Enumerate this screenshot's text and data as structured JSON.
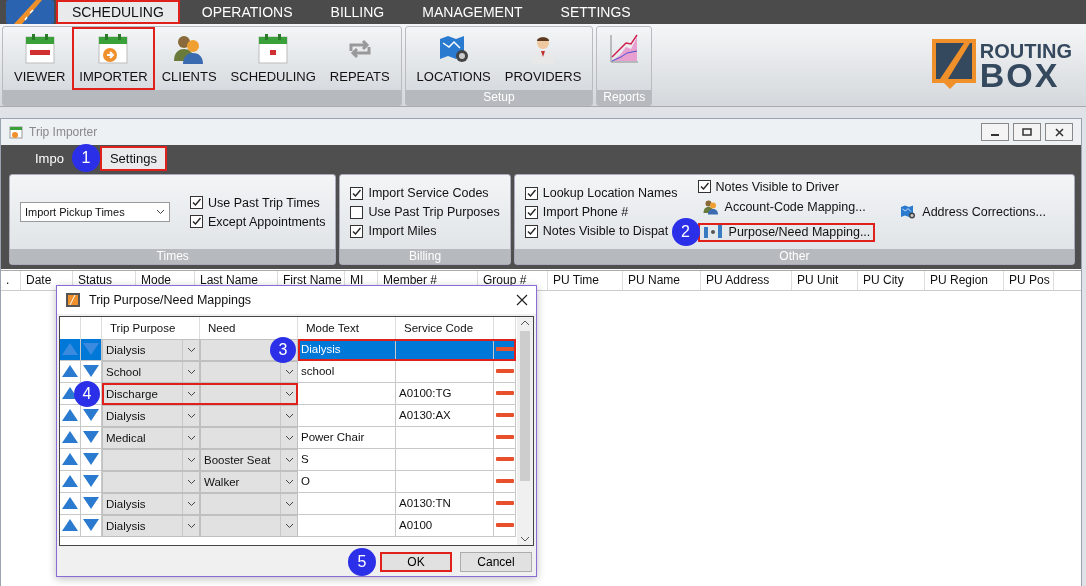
{
  "menu": [
    {
      "label": "SCHEDULING",
      "selected": true,
      "highlighted": true
    },
    {
      "label": "OPERATIONS",
      "selected": false,
      "highlighted": false
    },
    {
      "label": "BILLING",
      "selected": false,
      "highlighted": false
    },
    {
      "label": "MANAGEMENT",
      "selected": false,
      "highlighted": false
    },
    {
      "label": "SETTINGS",
      "selected": false,
      "highlighted": false
    }
  ],
  "ribbon": {
    "groups": [
      {
        "buttons": [
          {
            "label": "VIEWER",
            "highlighted": false
          },
          {
            "label": "IMPORTER",
            "highlighted": true
          },
          {
            "label": "CLIENTS",
            "highlighted": false
          },
          {
            "label": "SCHEDULING",
            "highlighted": false
          },
          {
            "label": "REPEATS",
            "highlighted": false
          }
        ]
      },
      {
        "label": "Setup",
        "buttons": [
          {
            "label": "LOCATIONS",
            "highlighted": false
          },
          {
            "label": "PROVIDERS",
            "highlighted": false
          }
        ]
      },
      {
        "label": "Reports",
        "buttons": [
          {
            "highlighted": false
          }
        ]
      }
    ],
    "logo": {
      "line1": "ROUTING",
      "line2": "BOX"
    }
  },
  "window": {
    "title": "Trip Importer",
    "tabs": [
      {
        "label": "Impo",
        "selected": false,
        "highlighted": false
      },
      {
        "label": "Settings",
        "selected": true,
        "highlighted": true,
        "callout": "1"
      }
    ],
    "groups": [
      {
        "label": "Times",
        "columns": [
          [
            {
              "kind": "select",
              "value": "Import Pickup Times"
            }
          ],
          [
            {
              "kind": "checkbox",
              "label": "Use Past Trip Times",
              "checked": true
            },
            {
              "kind": "checkbox",
              "label": "Except Appointments",
              "checked": true
            }
          ]
        ]
      },
      {
        "label": "Billing",
        "columns": [
          [
            {
              "kind": "checkbox",
              "label": "Import Service Codes",
              "checked": true
            },
            {
              "kind": "checkbox",
              "label": "Use Past Trip Purposes",
              "checked": false
            },
            {
              "kind": "checkbox",
              "label": "Import Miles",
              "checked": true
            }
          ]
        ]
      },
      {
        "label": "Other",
        "columns": [
          [
            {
              "kind": "checkbox",
              "label": "Lookup Location Names",
              "checked": true
            },
            {
              "kind": "checkbox",
              "label": "Import Phone #",
              "checked": true
            },
            {
              "kind": "checkbox",
              "label": "Notes Visible to Dispat",
              "checked": true
            }
          ],
          [
            {
              "kind": "checkbox",
              "label": "Notes Visible to Driver",
              "checked": true
            },
            {
              "kind": "link",
              "label": "Account-Code Mapping...",
              "highlighted": false
            },
            {
              "kind": "link",
              "label": "Purpose/Need Mapping...",
              "highlighted": true,
              "callout": "2"
            }
          ],
          [
            {
              "kind": "link",
              "label": "Address Corrections...",
              "highlighted": false
            }
          ]
        ]
      }
    ],
    "table": {
      "columns": [
        ".",
        "Date",
        "Status",
        "Mode",
        "Last Name",
        "First Name",
        "MI",
        "Member #",
        "Group #",
        "PU Time",
        "PU Name",
        "PU Address",
        "PU Unit",
        "PU City",
        "PU Region",
        "PU Pos"
      ]
    }
  },
  "dialog": {
    "title": "Trip Purpose/Need Mappings",
    "columns": [
      "Trip Purpose",
      "Need",
      "Mode Text",
      "Service Code"
    ],
    "rows": [
      {
        "selected": true,
        "purpose": "Dialysis",
        "mode_text": "Dialysis",
        "mode_highlighted": true,
        "purpose_highlighted": false,
        "callout": "3"
      },
      {
        "selected": false,
        "purpose": "School",
        "mode_text": "school",
        "mode_highlighted": false,
        "purpose_highlighted": false
      },
      {
        "selected": false,
        "purpose": "Discharge",
        "service_code": "A0100:TG",
        "mode_highlighted": false,
        "purpose_highlighted": true,
        "callout": "4"
      },
      {
        "selected": false,
        "purpose": "Dialysis",
        "service_code": "A0130:AX",
        "mode_highlighted": false,
        "purpose_highlighted": false
      },
      {
        "selected": false,
        "purpose": "Medical",
        "mode_text": "Power Chair",
        "mode_highlighted": false,
        "purpose_highlighted": false
      },
      {
        "selected": false,
        "need": "Booster Seat",
        "mode_text": "S",
        "mode_highlighted": false,
        "purpose_highlighted": false
      },
      {
        "selected": false,
        "need": "Walker",
        "mode_text": "O",
        "mode_highlighted": false,
        "purpose_highlighted": false
      },
      {
        "selected": false,
        "purpose": "Dialysis",
        "service_code": "A0130:TN",
        "mode_highlighted": false,
        "purpose_highlighted": false
      },
      {
        "selected": false,
        "purpose": "Dialysis",
        "service_code": "A0100",
        "mode_highlighted": false,
        "purpose_highlighted": false
      }
    ],
    "buttons": [
      {
        "label": "OK",
        "highlighted": true,
        "callout": "5"
      },
      {
        "label": "Cancel",
        "highlighted": false
      }
    ]
  }
}
